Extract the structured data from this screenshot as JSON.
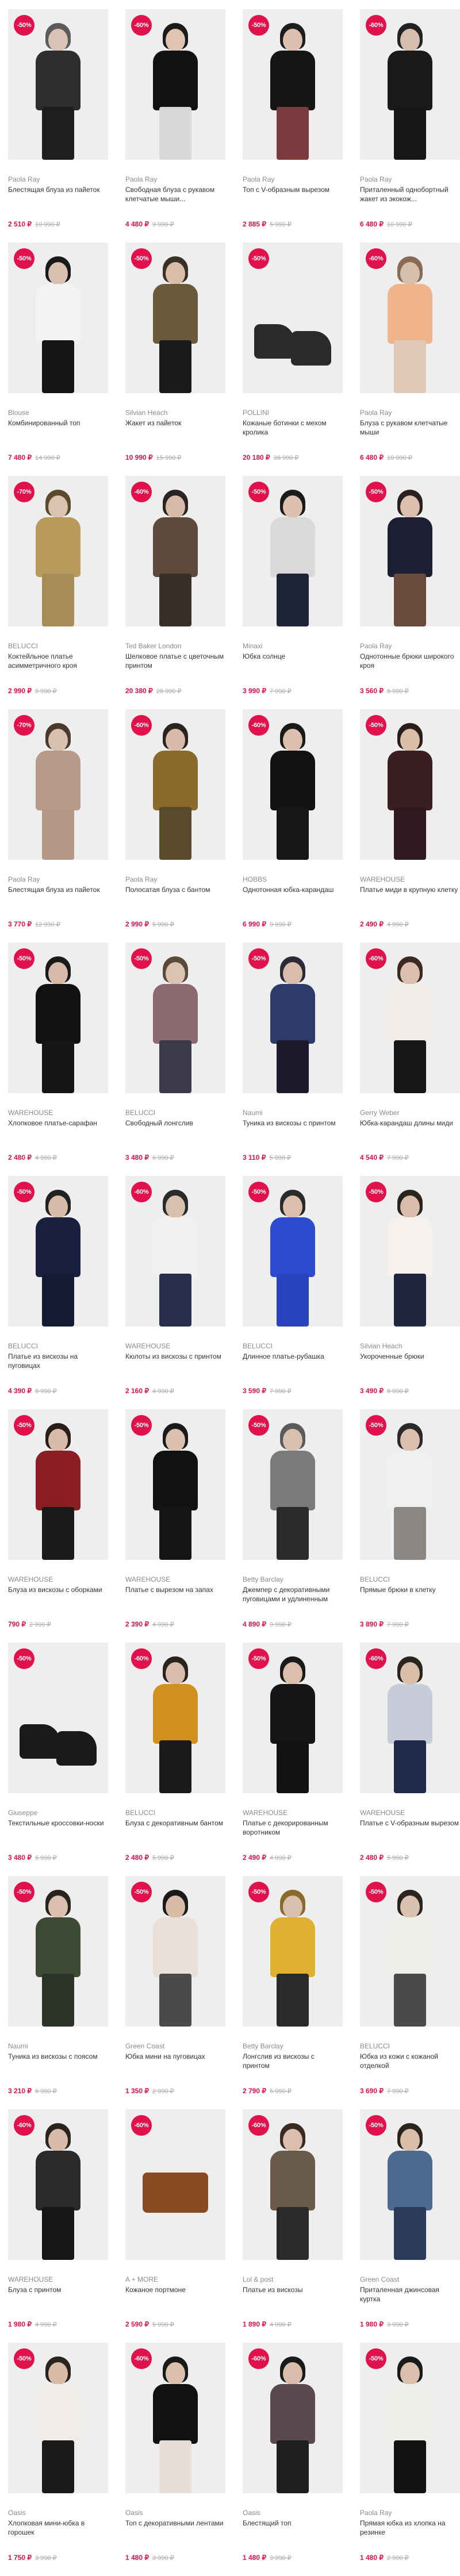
{
  "colors": {
    "accent": "#e0114b",
    "photo_bg": "#eeeeee",
    "muted": "#8a8a8a",
    "old_price": "#aaaaaa"
  },
  "products": [
    {
      "badge": "-50%",
      "brand": "Paola Ray",
      "title": "Блестящая блуза из пайеток",
      "price": "2 510 ₽",
      "old_price": "10 990 ₽",
      "colors": [
        "#5b5a5c",
        "#2d2c2e",
        "#1e1e1e",
        "#d9c3b5"
      ]
    },
    {
      "badge": "-60%",
      "brand": "Paola Ray",
      "title": "Свободная блуза с рукавом клетчатые мыши...",
      "price": "4 480 ₽",
      "old_price": "9 990 ₽",
      "colors": [
        "#1b1b1b",
        "#111111",
        "#d8d8d8",
        "#e0c4b1"
      ]
    },
    {
      "badge": "-50%",
      "brand": "Paola Ray",
      "title": "Топ с V-образным вырезом",
      "price": "2 885 ₽",
      "old_price": "5 990 ₽",
      "colors": [
        "#1d1d1d",
        "#151515",
        "#7a3b3e",
        "#dcbfae"
      ]
    },
    {
      "badge": "-60%",
      "brand": "Paola Ray",
      "title": "Приталенный однобортный жакет из экокож...",
      "price": "6 480 ₽",
      "old_price": "10 990 ₽",
      "colors": [
        "#222222",
        "#1a1a1a",
        "#161616",
        "#d7bdae"
      ]
    },
    {
      "badge": "-50%",
      "brand": "Blouse",
      "title": "Комбинированный топ",
      "price": "7 480 ₽",
      "old_price": "14 990 ₽",
      "colors": [
        "#1a1a1a",
        "#f2f2f2",
        "#151515",
        "#d9c0b0"
      ]
    },
    {
      "badge": "-50%",
      "brand": "Silvian Heach",
      "title": "Жакет из пайеток",
      "price": "10 990 ₽",
      "old_price": "15 990 ₽",
      "colors": [
        "#3a3026",
        "#6b5a3a",
        "#1a1a1a",
        "#d8bda9"
      ]
    },
    {
      "badge": "-50%",
      "brand": "POLLINI",
      "title": "Кожаные ботинки с мехом кролика",
      "price": "20 180 ₽",
      "old_price": "38 990 ₽",
      "product": "boot",
      "colors": [
        "#2c2a28",
        "#b58b6a"
      ]
    },
    {
      "badge": "-60%",
      "brand": "Paola Ray",
      "title": "Блуза с рукавом клетчатые мыши",
      "price": "6 480 ₽",
      "old_price": "10 990 ₽",
      "colors": [
        "#8a6a52",
        "#f0b48a",
        "#dfc8b8",
        "#d7bfae"
      ]
    },
    {
      "badge": "-70%",
      "brand": "BELUCCI",
      "title": "Коктейльное платье асимметричного кроя",
      "price": "2 990 ₽",
      "old_price": "9 990 ₽",
      "colors": [
        "#5a4a2e",
        "#b89a5c",
        "#a88c55",
        "#dcc3b0"
      ]
    },
    {
      "badge": "-60%",
      "brand": "Ted Baker London",
      "title": "Шелковое платье с цветочным принтом",
      "price": "20 380 ₽",
      "old_price": "28 990 ₽",
      "colors": [
        "#2a2522",
        "#5e4a3a",
        "#3a2f28",
        "#d6bba9"
      ]
    },
    {
      "badge": "-50%",
      "brand": "Minaxi",
      "title": "Юбка солнце",
      "price": "3 990 ₽",
      "old_price": "7 990 ₽",
      "colors": [
        "#1a1a1a",
        "#d9d9d9",
        "#1d2436",
        "#dcc1af"
      ]
    },
    {
      "badge": "-50%",
      "brand": "Paola Ray",
      "title": "Однотонные брюки широкого кроя",
      "price": "3 560 ₽",
      "old_price": "6 990 ₽",
      "colors": [
        "#2a2020",
        "#1d1d33",
        "#6a4a3a",
        "#dbbfad"
      ]
    },
    {
      "badge": "-70%",
      "brand": "Paola Ray",
      "title": "Блестящая блуза из пайеток",
      "price": "3 770 ₽",
      "old_price": "12 990 ₽",
      "colors": [
        "#4a3a2e",
        "#b89a8a",
        "#b59885",
        "#d9bfae"
      ]
    },
    {
      "badge": "-60%",
      "brand": "Paola Ray",
      "title": "Полосатая блуза с бантом",
      "price": "2 990 ₽",
      "old_price": "5 990 ₽",
      "colors": [
        "#2a241e",
        "#8a6a2a",
        "#5a4a2a",
        "#d8bca9"
      ]
    },
    {
      "badge": "-60%",
      "brand": "HOBBS",
      "title": "Однотонная юбка-карандаш",
      "price": "6 990 ₽",
      "old_price": "9 990 ₽",
      "colors": [
        "#1a1a1a",
        "#111111",
        "#161616",
        "#dbc0ae"
      ]
    },
    {
      "badge": "-50%",
      "brand": "WAREHOUSE",
      "title": "Платье миди в крупную клетку",
      "price": "2 490 ₽",
      "old_price": "4 990 ₽",
      "colors": [
        "#2a1e1a",
        "#3a1e24",
        "#2e1a1e",
        "#d9bea9"
      ]
    },
    {
      "badge": "-50%",
      "brand": "WAREHOUSE",
      "title": "Хлопковое платье-сарафан",
      "price": "2 480 ₽",
      "old_price": "4 990 ₽",
      "colors": [
        "#1a1a1a",
        "#111111",
        "#151515",
        "#d6bba8"
      ]
    },
    {
      "badge": "-50%",
      "brand": "BELUCCI",
      "title": "Свободный лонгслив",
      "price": "3 480 ₽",
      "old_price": "6 990 ₽",
      "colors": [
        "#5a4a3a",
        "#8a6a70",
        "#3a3a4a",
        "#dcc2b1"
      ]
    },
    {
      "badge": "-50%",
      "brand": "Naumi",
      "title": "Туника из вискозы с принтом",
      "price": "3 110 ₽",
      "old_price": "5 990 ₽",
      "colors": [
        "#2a2a3a",
        "#2e3a6a",
        "#1a1a2a",
        "#d8bdaa"
      ]
    },
    {
      "badge": "-60%",
      "brand": "Gerry Weber",
      "title": "Юбка-карандаш длины миди",
      "price": "4 540 ₽",
      "old_price": "7 990 ₽",
      "colors": [
        "#3a2a22",
        "#f0ece8",
        "#161616",
        "#dbbfad"
      ]
    },
    {
      "badge": "-50%",
      "brand": "BELUCCI",
      "title": "Платье из вискозы на пуговицах",
      "price": "4 390 ₽",
      "old_price": "8 990 ₽",
      "colors": [
        "#222222",
        "#1a2040",
        "#151a33",
        "#d7bcaa"
      ]
    },
    {
      "badge": "-60%",
      "brand": "WAREHOUSE",
      "title": "Кюлоты из вискозы с принтом",
      "price": "2 160 ₽",
      "old_price": "4 990 ₽",
      "colors": [
        "#2a2a2a",
        "#f0f0f0",
        "#2a2e4a",
        "#d9bfae"
      ]
    },
    {
      "badge": "-50%",
      "brand": "BELUCCI",
      "title": "Длинное платье-рубашка",
      "price": "3 590 ₽",
      "old_price": "7 990 ₽",
      "colors": [
        "#2a2a2a",
        "#2e4ad0",
        "#2a44c0",
        "#dbbfac"
      ]
    },
    {
      "badge": "-50%",
      "brand": "Silvian Heach",
      "title": "Укороченные брюки",
      "price": "3 490 ₽",
      "old_price": "6 990 ₽",
      "colors": [
        "#2a241e",
        "#f5f2ee",
        "#1e2640",
        "#d9bca9"
      ]
    },
    {
      "badge": "-50%",
      "brand": "WAREHOUSE",
      "title": "Блуза из вискозы с оборками",
      "price": "790 ₽",
      "old_price": "2 990 ₽",
      "colors": [
        "#2a1e1a",
        "#8a1e22",
        "#1a1a1a",
        "#d8bba8"
      ]
    },
    {
      "badge": "-50%",
      "brand": "WAREHOUSE",
      "title": "Платье с вырезом на запах",
      "price": "2 390 ₽",
      "old_price": "4 990 ₽",
      "colors": [
        "#1a1a1a",
        "#111111",
        "#151515",
        "#dbc0ae"
      ]
    },
    {
      "badge": "-50%",
      "brand": "Betty Barclay",
      "title": "Джемпер с декоративными пуговицами и удлиненным пуго...",
      "price": "4 890 ₽",
      "old_price": "9 990 ₽",
      "colors": [
        "#5a5a5a",
        "#7a7a7a",
        "#2a2a2a",
        "#d8bfae"
      ]
    },
    {
      "badge": "-50%",
      "brand": "BELUCCI",
      "title": "Прямые брюки в клетку",
      "price": "3 890 ₽",
      "old_price": "7 990 ₽",
      "colors": [
        "#2a2a2a",
        "#f0f0f0",
        "#8a8682",
        "#dbc0af"
      ]
    },
    {
      "badge": "-50%",
      "brand": "Giuseppe",
      "title": "Текстильные кроссовки-носки",
      "price": "3 480 ₽",
      "old_price": "6 990 ₽",
      "product": "boot",
      "colors": [
        "#1a1a1a",
        "#f2f2f2"
      ]
    },
    {
      "badge": "-60%",
      "brand": "BELUCCI",
      "title": "Блуза с декоративным бантом",
      "price": "2 480 ₽",
      "old_price": "5 990 ₽",
      "colors": [
        "#2a241e",
        "#d0901e",
        "#1a1a1a",
        "#d9bca9"
      ]
    },
    {
      "badge": "-50%",
      "brand": "WAREHOUSE",
      "title": "Платье с декорированным воротником",
      "price": "2 490 ₽",
      "old_price": "4 990 ₽",
      "colors": [
        "#1a1a1a",
        "#151515",
        "#121212",
        "#dbbfad"
      ]
    },
    {
      "badge": "-60%",
      "brand": "WAREHOUSE",
      "title": "Платье с V-образным вырезом",
      "price": "2 480 ₽",
      "old_price": "5 990 ₽",
      "colors": [
        "#2a241e",
        "#c8ccd8",
        "#1e2a4a",
        "#d8bda9"
      ]
    },
    {
      "badge": "-50%",
      "brand": "Naumi",
      "title": "Туника из вискозы с поясом",
      "price": "3 210 ₽",
      "old_price": "6 990 ₽",
      "colors": [
        "#2a241e",
        "#3e4a34",
        "#2a3326",
        "#dbc0ae"
      ]
    },
    {
      "badge": "-50%",
      "brand": "Green Coast",
      "title": "Юбка мини на пуговицах",
      "price": "1 350 ₽",
      "old_price": "2 990 ₽",
      "colors": [
        "#1a1a1a",
        "#e8dfd6",
        "#4a4a4a",
        "#d9bca8"
      ]
    },
    {
      "badge": "-50%",
      "brand": "Betty Barclay",
      "title": "Лонгслив из вискозы с принтом",
      "price": "2 790 ₽",
      "old_price": "5 990 ₽",
      "colors": [
        "#8a6a2a",
        "#e0b030",
        "#2a2a2a",
        "#d9bfad"
      ]
    },
    {
      "badge": "-50%",
      "brand": "BELUCCI",
      "title": "Юбка из кожи с кожаной отделкой",
      "price": "3 690 ₽",
      "old_price": "7 990 ₽",
      "colors": [
        "#2a241e",
        "#f0eeea",
        "#4a4a4a",
        "#dbc1af"
      ]
    },
    {
      "badge": "-60%",
      "brand": "WAREHOUSE",
      "title": "Блуза с принтом",
      "price": "1 980 ₽",
      "old_price": "4 990 ₽",
      "colors": [
        "#2a241e",
        "#2a2a2a",
        "#161616",
        "#d8bca9"
      ]
    },
    {
      "badge": "-60%",
      "brand": "A + MORE",
      "title": "Кожаное портмоне",
      "price": "2 590 ₽",
      "old_price": "5 990 ₽",
      "product": "wallet",
      "colors": [
        "#8a4a22",
        "#6a3a1a"
      ]
    },
    {
      "badge": "-60%",
      "brand": "Lol & post",
      "title": "Платье из вискозы",
      "price": "1 890 ₽",
      "old_price": "4 990 ₽",
      "colors": [
        "#3a2a22",
        "#6a5a4a",
        "#2a2a2a",
        "#dbbfac"
      ]
    },
    {
      "badge": "-50%",
      "brand": "Green Coast",
      "title": "Приталенная джинсовая куртка",
      "price": "1 980 ₽",
      "old_price": "3 990 ₽",
      "colors": [
        "#2a241e",
        "#4a6a90",
        "#2a3a5a",
        "#d9bda9"
      ]
    },
    {
      "badge": "-50%",
      "brand": "Oasis",
      "title": "Хлопковая мини-юбка в горошек",
      "price": "1 750 ₽",
      "old_price": "3 990 ₽",
      "colors": [
        "#2a241e",
        "#f0ece8",
        "#1a1a1a",
        "#d8bca8"
      ]
    },
    {
      "badge": "-60%",
      "brand": "Oasis",
      "title": "Топ с декоративными лентами",
      "price": "1 480 ₽",
      "old_price": "3 990 ₽",
      "colors": [
        "#1a1a1a",
        "#111111",
        "#e6dfd8",
        "#dbc0ae"
      ]
    },
    {
      "badge": "-60%",
      "brand": "Oasis",
      "title": "Блестящий топ",
      "price": "1 480 ₽",
      "old_price": "3 990 ₽",
      "colors": [
        "#1a1a1a",
        "#5a4a4e",
        "#1e1e1e",
        "#d9bdaa"
      ]
    },
    {
      "badge": "-50%",
      "brand": "Paola Ray",
      "title": "Прямая юбка из хлопка на резинке",
      "price": "1 480 ₽",
      "old_price": "2 990 ₽",
      "colors": [
        "#1a1a1a",
        "#f0eeea",
        "#121212",
        "#dbbfad"
      ]
    }
  ]
}
